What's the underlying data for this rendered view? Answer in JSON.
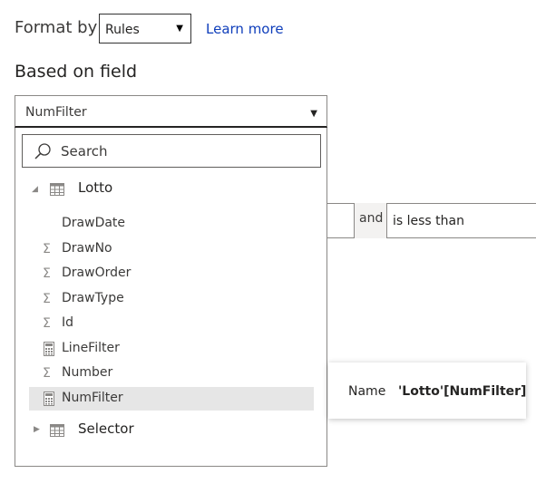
{
  "format": {
    "label": "Format by",
    "selected": "Rules",
    "learn_more": "Learn more"
  },
  "section_title": "Based on field",
  "field_select": {
    "value": "NumFilter"
  },
  "rule_row": {
    "and_label": "and",
    "condition": "is less than"
  },
  "dropdown": {
    "search_placeholder": "Search",
    "groups": [
      {
        "label": "Lotto",
        "expanded": true
      },
      {
        "label": "Selector",
        "expanded": false
      }
    ],
    "items": [
      {
        "label": "DrawDate",
        "icon": "none"
      },
      {
        "label": "DrawNo",
        "icon": "sigma-icon"
      },
      {
        "label": "DrawOrder",
        "icon": "sigma-icon"
      },
      {
        "label": "DrawType",
        "icon": "sigma-icon"
      },
      {
        "label": "Id",
        "icon": "sigma-icon"
      },
      {
        "label": "LineFilter",
        "icon": "calculator-icon"
      },
      {
        "label": "Number",
        "icon": "sigma-icon"
      },
      {
        "label": "NumFilter",
        "icon": "calculator-icon",
        "selected": true
      }
    ]
  },
  "tooltip": {
    "key": "Name",
    "value": "'Lotto'[NumFilter]"
  }
}
